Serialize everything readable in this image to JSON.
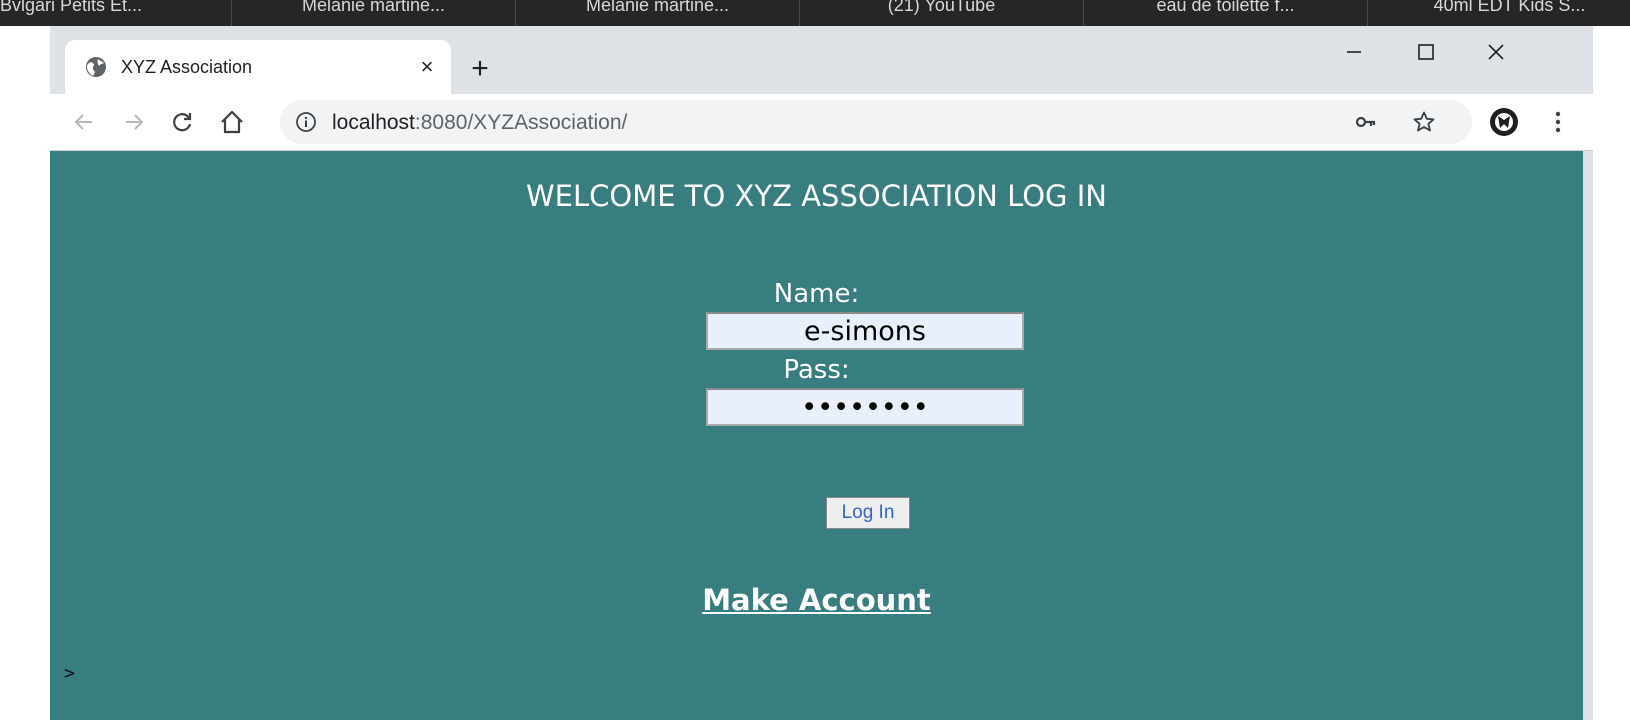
{
  "taskbar": {
    "items": [
      "Bvlgari Petits Et...",
      "Melanie martine...",
      "Melanie martine...",
      "(21) YouTube",
      "eau de toilette f...",
      "40ml EDT Kids S..."
    ]
  },
  "browser": {
    "tab_title": "XYZ Association",
    "new_tab_label": "+",
    "close_tab_label": "×",
    "url_host": "localhost",
    "url_rest": ":8080/XYZAssociation/"
  },
  "page": {
    "title": "WELCOME TO XYZ ASSOCIATION LOG IN",
    "name_label": "Name:",
    "name_value": "e-simons",
    "pass_label": "Pass:",
    "pass_value": "password",
    "login_button": "Log In",
    "make_account_link": "Make Account",
    "stray_text": ">"
  },
  "colors": {
    "page_background": "#387d7f",
    "input_background": "#e8f0fe",
    "button_text": "#3366cc",
    "chrome_frame": "#dee1e6",
    "taskbar": "#262626"
  }
}
